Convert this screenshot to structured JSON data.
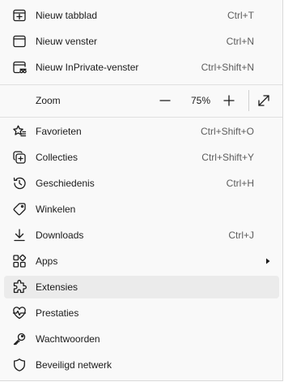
{
  "menu": {
    "items_top": [
      {
        "label": "Nieuw tabblad",
        "shortcut": "Ctrl+T",
        "icon": "new-tab-icon"
      },
      {
        "label": "Nieuw venster",
        "shortcut": "Ctrl+N",
        "icon": "new-window-icon"
      },
      {
        "label": "Nieuw InPrivate-venster",
        "shortcut": "Ctrl+Shift+N",
        "icon": "inprivate-window-icon"
      }
    ],
    "zoom": {
      "label": "Zoom",
      "value": "75%",
      "icons": [
        "zoom-out-icon",
        "zoom-in-icon",
        "fullscreen-icon"
      ]
    },
    "items_bottom": [
      {
        "label": "Favorieten",
        "shortcut": "Ctrl+Shift+O",
        "icon": "favorites-icon"
      },
      {
        "label": "Collecties",
        "shortcut": "Ctrl+Shift+Y",
        "icon": "collections-icon"
      },
      {
        "label": "Geschiedenis",
        "shortcut": "Ctrl+H",
        "icon": "history-icon"
      },
      {
        "label": "Winkelen",
        "shortcut": "",
        "icon": "shopping-tag-icon"
      },
      {
        "label": "Downloads",
        "shortcut": "Ctrl+J",
        "icon": "download-icon"
      },
      {
        "label": "Apps",
        "shortcut": "",
        "icon": "apps-icon",
        "submenu": true
      },
      {
        "label": "Extensies",
        "shortcut": "",
        "icon": "extensions-icon",
        "hovered": true
      },
      {
        "label": "Prestaties",
        "shortcut": "",
        "icon": "performance-icon"
      },
      {
        "label": "Wachtwoorden",
        "shortcut": "",
        "icon": "key-icon"
      },
      {
        "label": "Beveiligd netwerk",
        "shortcut": "",
        "icon": "shield-icon"
      }
    ]
  },
  "colors": {
    "menu_bg": "#f9f9f9",
    "hover_bg": "#ebebeb",
    "text": "#1b1b1b",
    "shortcut_text": "#5d5d5d"
  }
}
